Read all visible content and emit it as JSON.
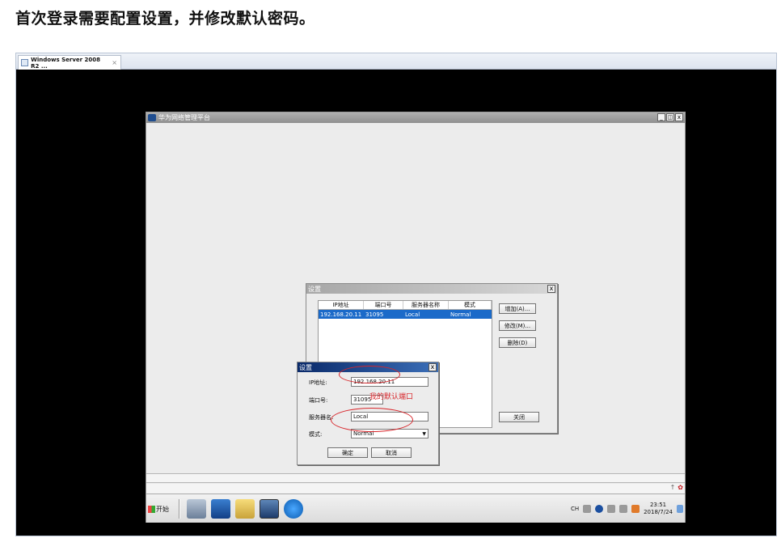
{
  "heading": "首次登录需要配置设置，并修改默认密码。",
  "tab": {
    "title": "Windows Server 2008 R2 ...",
    "close": "×"
  },
  "app": {
    "title": "华为网络管理平台",
    "controls": {
      "minimize": "_",
      "restore": "8",
      "close": "x"
    }
  },
  "settings_list_dialog": {
    "title": "设置",
    "close": "x",
    "columns": [
      "IP地址",
      "端口号",
      "服务器名称",
      "模式"
    ],
    "rows": [
      [
        "192.168.20.11",
        "31095",
        "Local",
        "Normal"
      ]
    ],
    "buttons": {
      "add": "增加(A)...",
      "modify": "修改(M)...",
      "delete": "删除(D)",
      "close": "关闭"
    }
  },
  "settings_edit_dialog": {
    "title": "设置",
    "close": "x",
    "labels": {
      "ip": "IP地址:",
      "port": "端口号:",
      "server": "服务器名:",
      "mode": "模式:"
    },
    "values": {
      "ip": "192.168.20.11",
      "port": "31095",
      "server": "Local",
      "mode": "Normal"
    },
    "buttons": {
      "ok": "确定",
      "cancel": "取消"
    }
  },
  "annotation": "我的默认端口",
  "taskbar": {
    "start": "开始",
    "lang": "CH",
    "time": "23:51",
    "date": "2018/7/24"
  },
  "colors": {
    "selection": "#1b6ac9",
    "annotation": "#d8262b",
    "dialog_title": "#0a2a6a"
  }
}
